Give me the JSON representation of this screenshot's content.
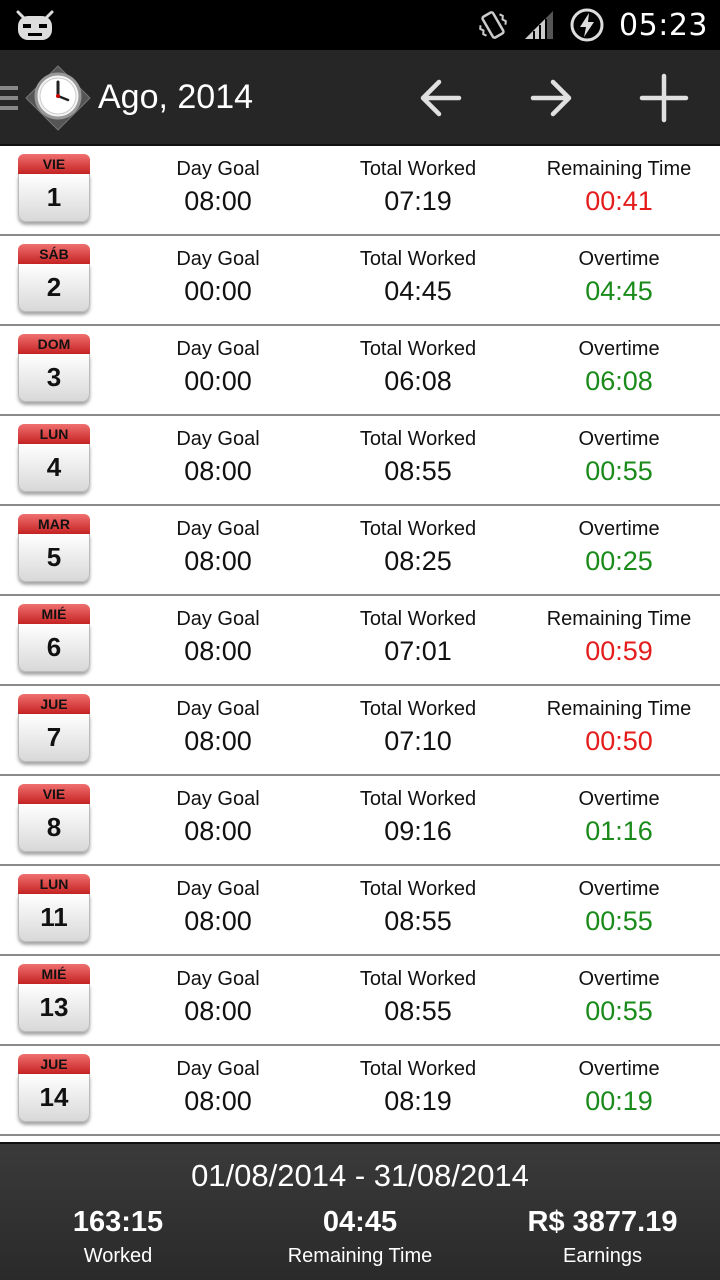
{
  "status_bar": {
    "time": "05:23",
    "icons": [
      "cyanogen-mod-icon",
      "vibrate-icon",
      "signal-icon",
      "battery-charging-icon"
    ]
  },
  "action_bar": {
    "title": "Ago, 2014",
    "icons": [
      "clock-app-icon",
      "arrow-left-icon",
      "arrow-right-icon",
      "plus-icon"
    ]
  },
  "days": [
    {
      "weekday": "VIE",
      "day": "1",
      "goal_label": "Day Goal",
      "goal": "08:00",
      "worked_label": "Total Worked",
      "worked": "07:19",
      "status_label": "Remaining Time",
      "status": "00:41",
      "status_color": "#e51c1c"
    },
    {
      "weekday": "SÁB",
      "day": "2",
      "goal_label": "Day Goal",
      "goal": "00:00",
      "worked_label": "Total Worked",
      "worked": "04:45",
      "status_label": "Overtime",
      "status": "04:45",
      "status_color": "#1a8a1a"
    },
    {
      "weekday": "DOM",
      "day": "3",
      "goal_label": "Day Goal",
      "goal": "00:00",
      "worked_label": "Total Worked",
      "worked": "06:08",
      "status_label": "Overtime",
      "status": "06:08",
      "status_color": "#1a8a1a"
    },
    {
      "weekday": "LUN",
      "day": "4",
      "goal_label": "Day Goal",
      "goal": "08:00",
      "worked_label": "Total Worked",
      "worked": "08:55",
      "status_label": "Overtime",
      "status": "00:55",
      "status_color": "#1a8a1a"
    },
    {
      "weekday": "MAR",
      "day": "5",
      "goal_label": "Day Goal",
      "goal": "08:00",
      "worked_label": "Total Worked",
      "worked": "08:25",
      "status_label": "Overtime",
      "status": "00:25",
      "status_color": "#1a8a1a"
    },
    {
      "weekday": "MIÉ",
      "day": "6",
      "goal_label": "Day Goal",
      "goal": "08:00",
      "worked_label": "Total Worked",
      "worked": "07:01",
      "status_label": "Remaining Time",
      "status": "00:59",
      "status_color": "#e51c1c"
    },
    {
      "weekday": "JUE",
      "day": "7",
      "goal_label": "Day Goal",
      "goal": "08:00",
      "worked_label": "Total Worked",
      "worked": "07:10",
      "status_label": "Remaining Time",
      "status": "00:50",
      "status_color": "#e51c1c"
    },
    {
      "weekday": "VIE",
      "day": "8",
      "goal_label": "Day Goal",
      "goal": "08:00",
      "worked_label": "Total Worked",
      "worked": "09:16",
      "status_label": "Overtime",
      "status": "01:16",
      "status_color": "#1a8a1a"
    },
    {
      "weekday": "LUN",
      "day": "11",
      "goal_label": "Day Goal",
      "goal": "08:00",
      "worked_label": "Total Worked",
      "worked": "08:55",
      "status_label": "Overtime",
      "status": "00:55",
      "status_color": "#1a8a1a"
    },
    {
      "weekday": "MIÉ",
      "day": "13",
      "goal_label": "Day Goal",
      "goal": "08:00",
      "worked_label": "Total Worked",
      "worked": "08:55",
      "status_label": "Overtime",
      "status": "00:55",
      "status_color": "#1a8a1a"
    },
    {
      "weekday": "JUE",
      "day": "14",
      "goal_label": "Day Goal",
      "goal": "08:00",
      "worked_label": "Total Worked",
      "worked": "08:19",
      "status_label": "Overtime",
      "status": "00:19",
      "status_color": "#1a8a1a"
    }
  ],
  "footer": {
    "range": "01/08/2014 - 31/08/2014",
    "worked_value": "163:15",
    "worked_label": "Worked",
    "remaining_value": "04:45",
    "remaining_label": "Remaining Time",
    "earnings_value": "R$ 3877.19",
    "earnings_label": "Earnings"
  }
}
